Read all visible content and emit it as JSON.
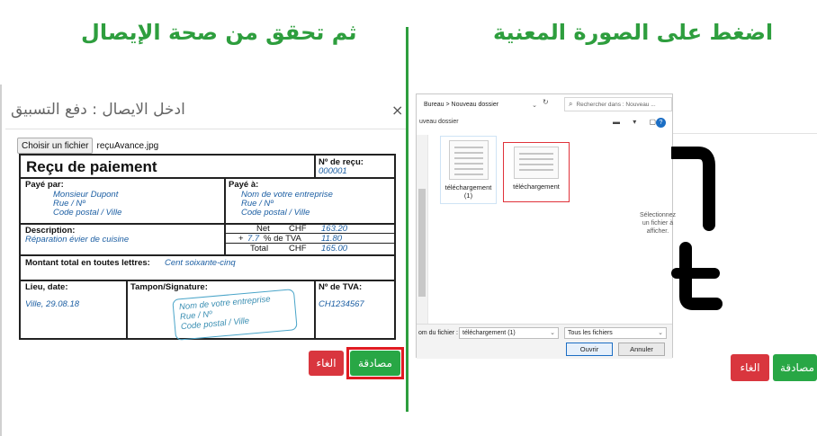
{
  "headings": {
    "left": "ثم تحقق من صحة الإيصال",
    "right": "اضغط على الصورة المعنية"
  },
  "left_modal": {
    "title": "ادخل الايصال : دفع التسبيق",
    "close_label": "×",
    "choose_file_label": "Choisir un fichier",
    "file_name": "reçuAvance.jpg",
    "cancel_label": "الغاء",
    "confirm_label": "مصادقة"
  },
  "receipt": {
    "title": "Reçu de paiement",
    "receipt_no_label": "Nº de reçu:",
    "receipt_no": "000001",
    "paid_by_label": "Payé par:",
    "paid_by": [
      "Monsieur Dupont",
      "Rue / Nº",
      "Code postal / Ville"
    ],
    "paid_to_label": "Payé à:",
    "paid_to": [
      "Nom de votre entreprise",
      "Rue / Nº",
      "Code postal / Ville"
    ],
    "description_label": "Description:",
    "description": "Réparation évier de cuisine",
    "net_label": "Net",
    "net_currency": "CHF",
    "net_value": "163.20",
    "tva_prefix": "+",
    "tva_rate": "7.7",
    "tva_label": "% de TVA",
    "tva_value": "11.80",
    "total_label": "Total",
    "total_currency": "CHF",
    "total_value": "165.00",
    "total_words_label": "Montant total en toutes lettres:",
    "total_words": "Cent soixante-cinq",
    "place_date_label": "Lieu, date:",
    "place_date": "Ville, 29.08.18",
    "stamp_label": "Tampon/Signature:",
    "stamp_lines": [
      "Nom de votre entreprise",
      "Rue / Nº",
      "Code postal / Ville"
    ],
    "tva_no_label": "Nº de TVA:",
    "tva_no": "CH1234567"
  },
  "file_dialog": {
    "breadcrumb": "Bureau > Nouveau dossier",
    "search_placeholder": "Rechercher dans : Nouveau ...",
    "organize_label": "uveau dossier",
    "files": [
      {
        "name": "téléchargement (1)"
      },
      {
        "name": "téléchargement"
      }
    ],
    "file_name_label": "om du fichier :",
    "file_name_value": "téléchargement (1)",
    "file_type_value": "Tous les fichiers",
    "open_label": "Ouvrir",
    "cancel_label": "Annuler"
  },
  "right_modal": {
    "hint": "Sélectionnez un fichier à afficher.",
    "cancel_label": "الغاء",
    "confirm_label": "مصادقة"
  },
  "colors": {
    "accent_green": "#2e9e3e",
    "confirm_green": "#28a745",
    "cancel_red": "#d9363e",
    "highlight_red": "#e01b22",
    "receipt_blue": "#1d5fa3"
  },
  "icons": [
    "close-icon",
    "search-icon",
    "help-icon",
    "chevron-down-icon",
    "file-thumbnail-icon"
  ]
}
